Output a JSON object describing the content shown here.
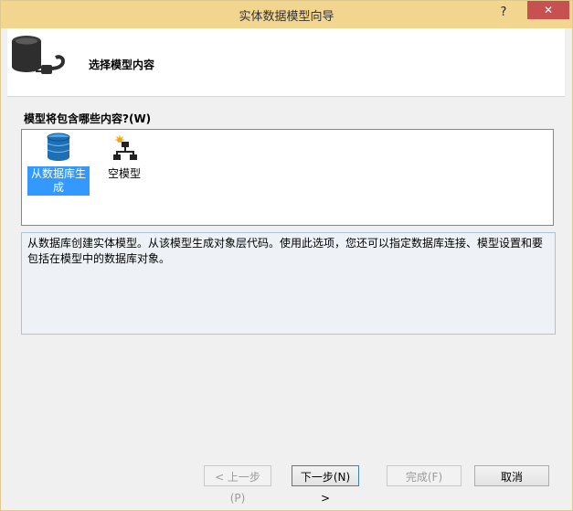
{
  "window": {
    "title": "实体数据模型向导",
    "help_label": "?",
    "close_label": "✕"
  },
  "header": {
    "title": "选择模型内容"
  },
  "content": {
    "label": "模型将包含哪些内容?(W)",
    "items": [
      {
        "label": "从数据库生成",
        "icon": "database-icon",
        "selected": true
      },
      {
        "label": "空模型",
        "icon": "empty-model-icon",
        "selected": false
      }
    ],
    "description": "从数据库创建实体模型。从该模型生成对象层代码。使用此选项，您还可以指定数据库连接、模型设置和要包括在模型中的数据库对象。"
  },
  "buttons": {
    "back": "< 上一步(P)",
    "next": "下一步(N) >",
    "finish": "完成(F)",
    "cancel": "取消"
  },
  "colors": {
    "titlebar": "#f2d58f",
    "selection": "#3399ff",
    "close_button": "#c75050"
  }
}
